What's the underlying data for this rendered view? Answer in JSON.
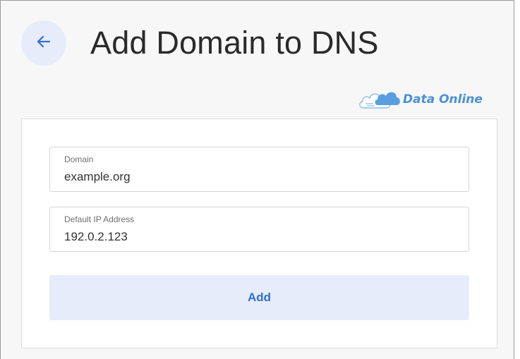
{
  "header": {
    "title": "Add Domain to DNS",
    "back_icon": "arrow-left-icon"
  },
  "logo": {
    "text": "Data Online",
    "icon": "cloud-icon"
  },
  "form": {
    "domain": {
      "label": "Domain",
      "value": "example.org"
    },
    "ip": {
      "label": "Default IP Address",
      "value": "192.0.2.123"
    },
    "submit_label": "Add"
  },
  "colors": {
    "accent": "#2f6fd6",
    "button_bg": "#e6ecf9",
    "page_bg": "#f7f7f7",
    "logo": "#4a90d6"
  }
}
